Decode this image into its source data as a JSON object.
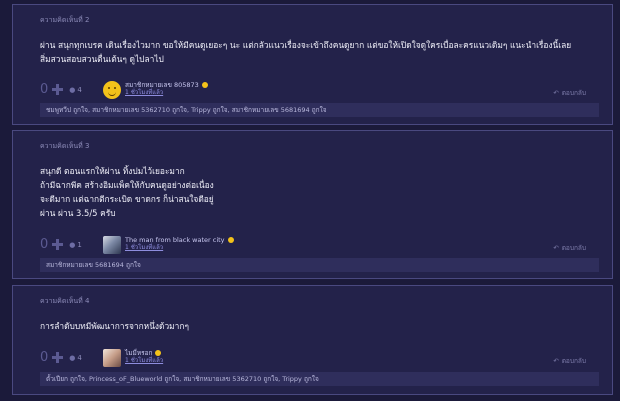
{
  "comments": [
    {
      "label": "ความคิดเห็นที่ 2",
      "lines": [
        "ผ่าน สนุกทุกเบรค เดินเรื่องไวมาก ขอให้มีคนดูเยอะๆ นะ แต่กลัวแนวเรื่องจะเข้าถึงคนดูยาก แต่ขอให้เปิดใจดูใครเบื่อละครแนวเดิมๆ แนะนำเรื่องนี้เลย",
        "สิ่มสวนสอบสวนตื่นเต้นๆ ดูไปลาไป"
      ],
      "votes": "0",
      "emo_count": "4",
      "user_name": "สมาชิกหมายเลข 805873",
      "user_time": "1 ชั่วโมงที่แล้ว",
      "reply_label": "ตอบกลับ",
      "likes": "ชมพูทวีป ถูกใจ, สมาชิกหมายเลข 5362710 ถูกใจ, Trippy ถูกใจ, สมาชิกหมายเลข 5681694 ถูกใจ"
    },
    {
      "label": "ความคิดเห็นที่ 3",
      "lines": [
        "สนุกดี ตอนแรกให้ผ่าน ทิ้งปมไว้เยอะมาก",
        "ถ้ามีฉากพีค สร้างอิมแพ็คให้กับคนดูอย่างต่อเนื่อง",
        "จะดีมาก แต่ฉากตีกระเบิด ขาดกร ก็น่าสนใจดีอยู่",
        "ผ่าน ผ่าน 3.5/5 ครับ"
      ],
      "votes": "0",
      "emo_count": "1",
      "user_name": "The man from black water city",
      "user_time": "1 ชั่วโมงที่แล้ว",
      "reply_label": "ตอบกลับ",
      "likes": "สมาชิกหมายเลข 5681694 ถูกใจ"
    },
    {
      "label": "ความคิดเห็นที่ 4",
      "lines": [
        "การลำดับบทมีพัฒนาการจากหนึ่งด้วมากๆ"
      ],
      "votes": "0",
      "emo_count": "4",
      "user_name": "ไมมี่หรอก",
      "user_time": "1 ชั่วโมงที่แล้ว",
      "reply_label": "ตอบกลับ",
      "likes": "ตั้วเปียก ถูกใจ, Princess_oF_Blueworld ถูกใจ, สมาชิกหมายเลข 5362710 ถูกใจ, Trippy ถูกใจ"
    }
  ],
  "icons": {
    "plus": "plus-icon",
    "emotion": "emotion-icon",
    "reply": "reply-arrow-icon"
  }
}
